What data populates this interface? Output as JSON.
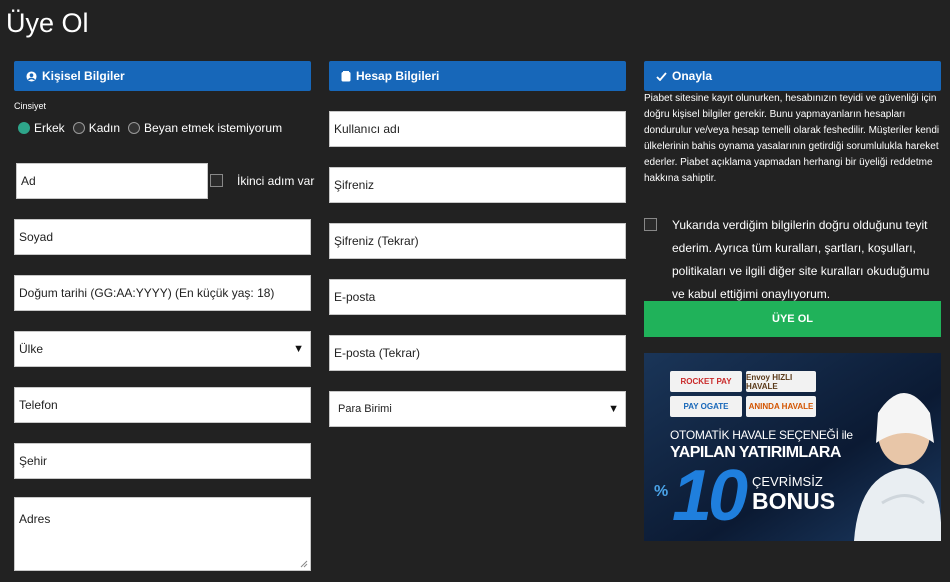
{
  "page": {
    "title": "Üye Ol"
  },
  "personal": {
    "header": "Kişisel Bilgiler",
    "gender_label": "Cinsiyet",
    "genders": [
      "Erkek",
      "Kadın",
      "Beyan etmek istemiyorum"
    ],
    "selected_gender": "Erkek",
    "first_name_placeholder": "Ad",
    "second_name_label": "İkinci adım var",
    "surname_placeholder": "Soyad",
    "dob_placeholder": "Doğum tarihi (GG:AA:YYYY) (En küçük yaş: 18)",
    "country_selected": "Ülke",
    "phone_placeholder": "Telefon",
    "city_placeholder": "Şehir",
    "address_placeholder": "Adres"
  },
  "account": {
    "header": "Hesap Bilgileri",
    "username_placeholder": "Kullanıcı adı",
    "password_placeholder": "Şifreniz",
    "password_confirm_placeholder": "Şifreniz (Tekrar)",
    "email_placeholder": "E-posta",
    "email_confirm_placeholder": "E-posta (Tekrar)",
    "currency_selected": "Para Birimi"
  },
  "confirm": {
    "header": "Onayla",
    "info": "Piabet sitesine kayıt olunurken, hesabınızın teyidi ve güvenliği için doğru kişisel bilgiler gerekir. Bunu yapmayanların hesapları dondurulur ve/veya hesap temelli olarak feshedilir. Müşteriler kendi ülkelerinin bahis oynama yasalarının getirdiği sorumlulukla hareket ederler. Piabet açıklama yapmadan herhangi bir üyeliği reddetme hakkına sahiptir.",
    "agree_text": "Yukarıda verdiğim bilgilerin doğru olduğunu teyit ederim. Ayrıca tüm kuralları, şartları, koşulları, politikaları ve ilgili diğer site kuralları okuduğumu ve kabul ettiğimi onaylıyorum.",
    "submit_label": "ÜYE OL"
  },
  "banner": {
    "logos": [
      "ROCKET PAY",
      "Envoy HIZLI HAVALE",
      "PAY OGATE",
      "ANINDA HAVALE"
    ],
    "line1": "OTOMATİK HAVALE SEÇENEĞİ ile",
    "line2": "YAPILAN YATIRIMLARA",
    "percent_sign": "%",
    "big_number": "10",
    "bonus_top": "ÇEVRİMSİZ",
    "bonus_bottom": "BONUS"
  },
  "colors": {
    "header_blue": "#1767b9",
    "submit_green": "#20b25a",
    "radio_teal": "#2ea58a"
  }
}
